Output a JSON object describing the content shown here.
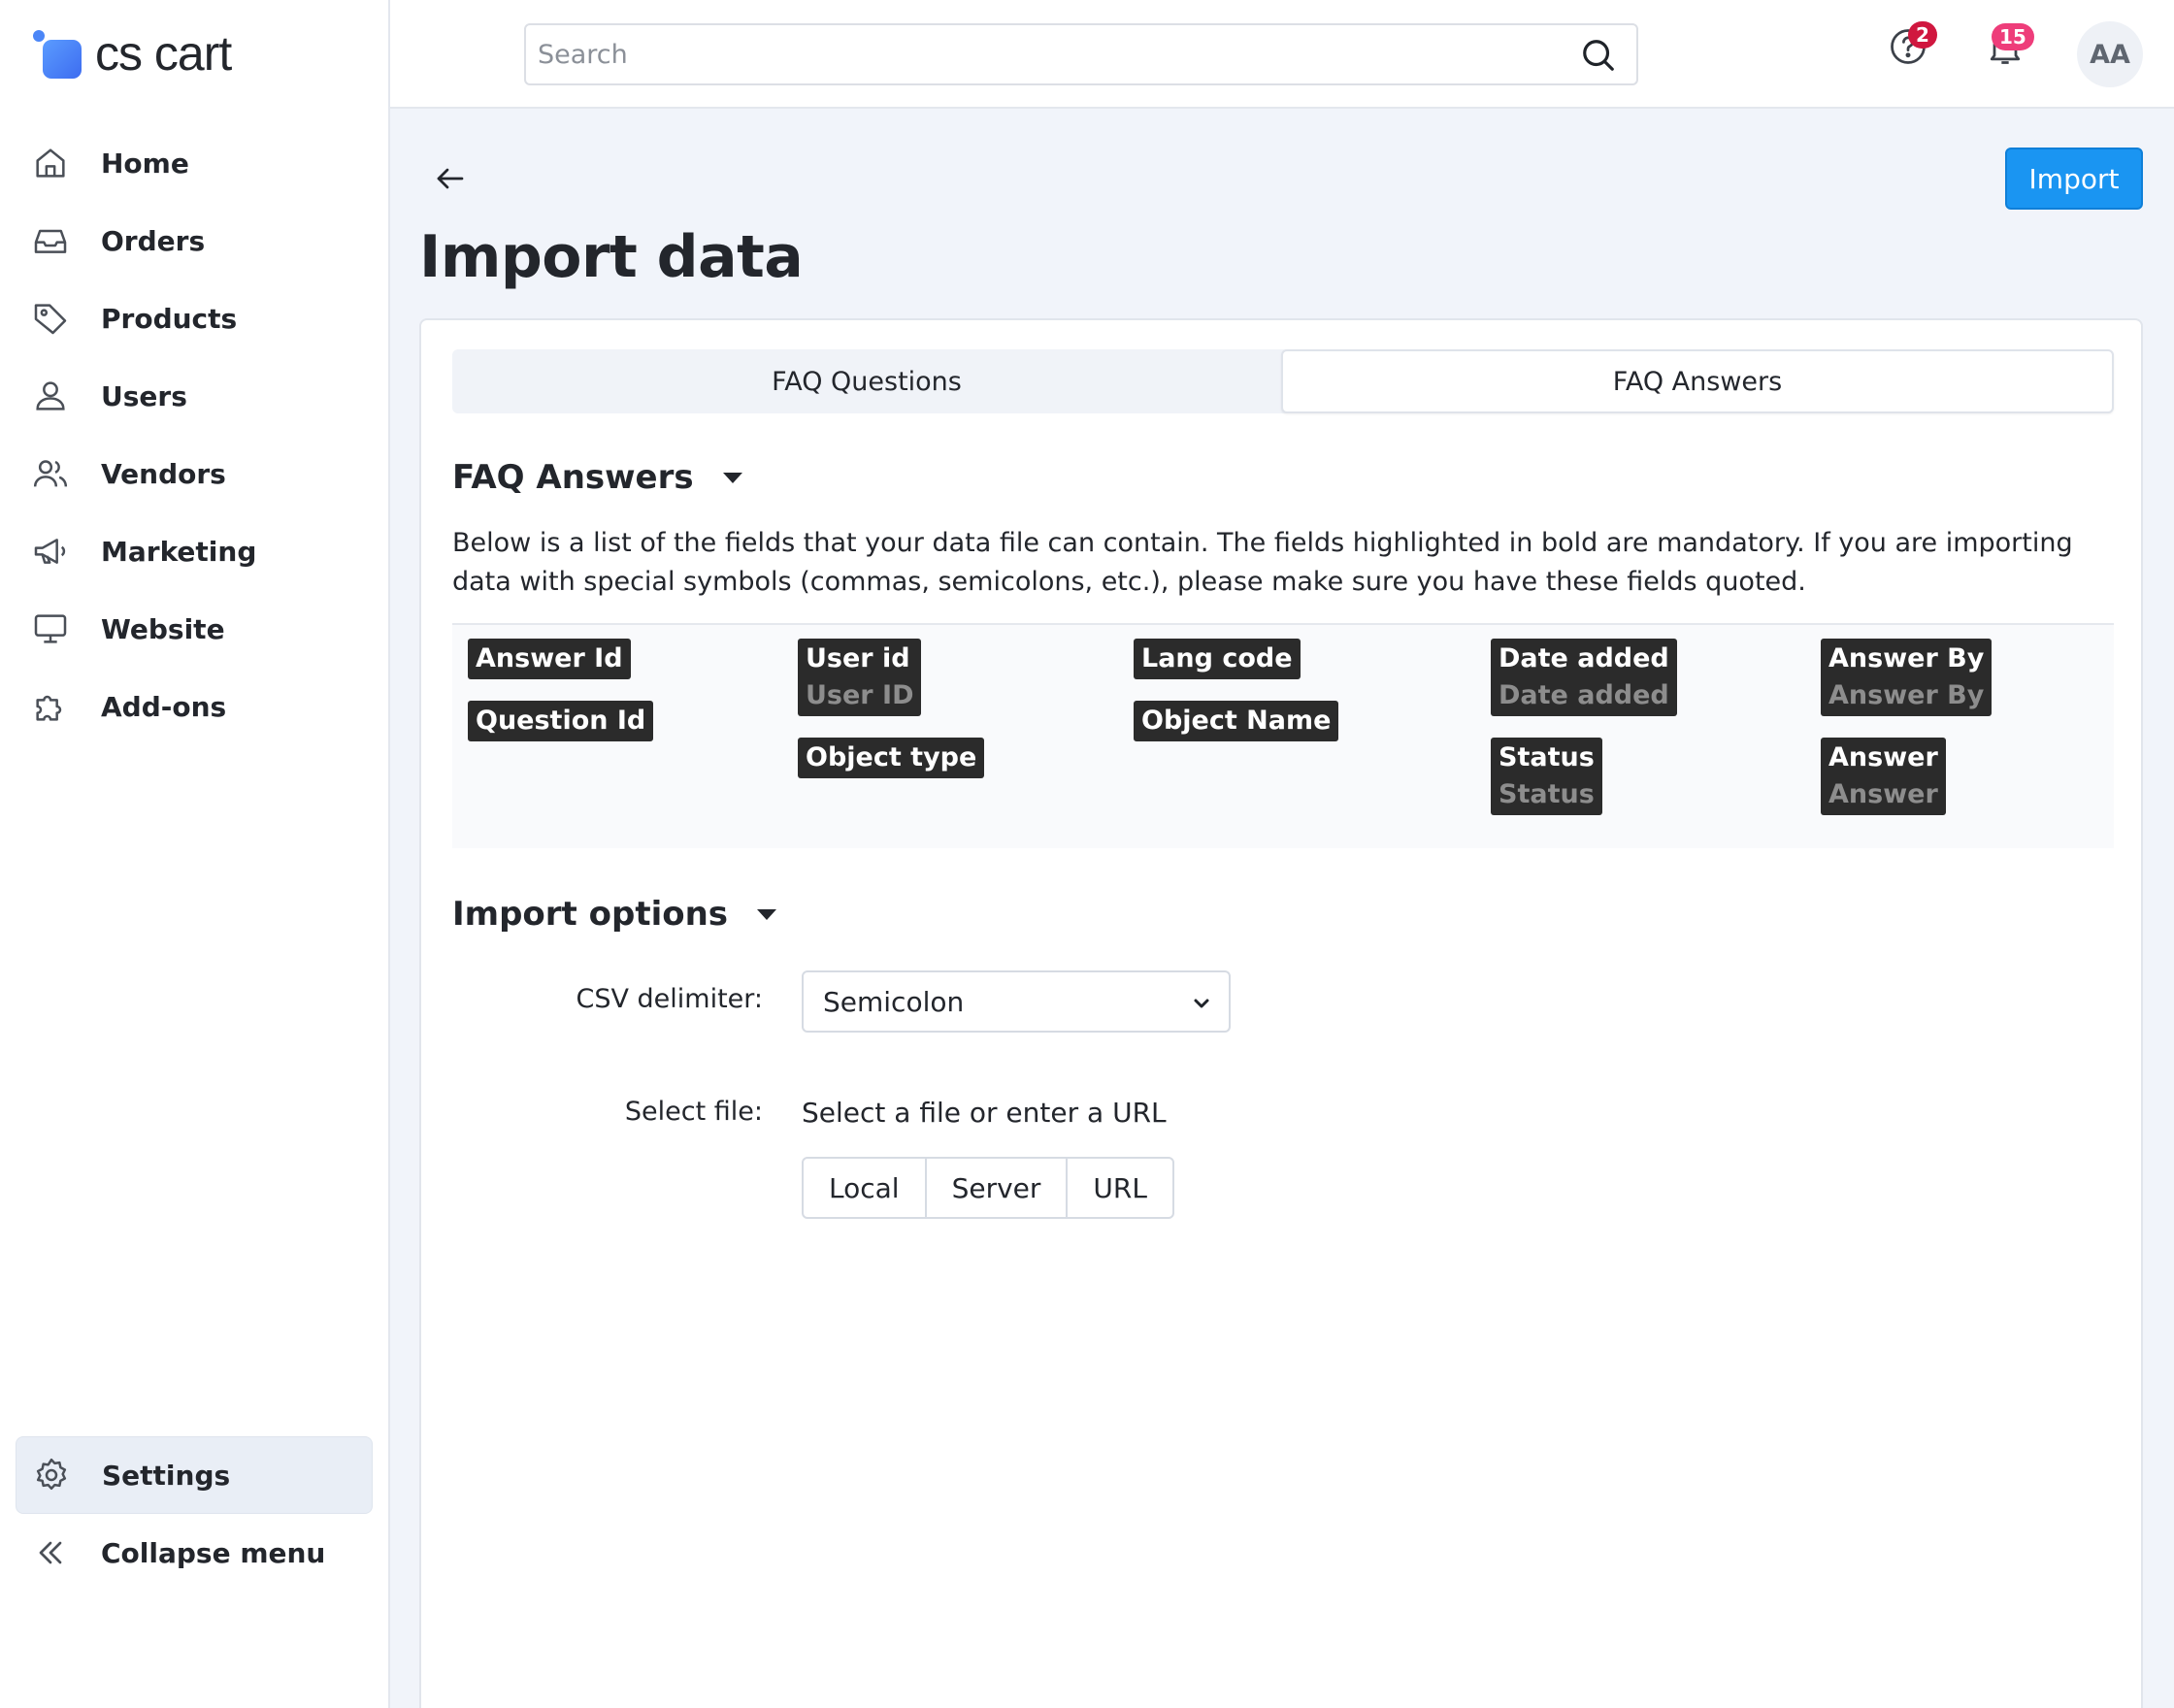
{
  "app": {
    "logo_text": "cs cart"
  },
  "sidebar": {
    "items": [
      {
        "label": "Home",
        "icon": "home-icon"
      },
      {
        "label": "Orders",
        "icon": "inbox-icon"
      },
      {
        "label": "Products",
        "icon": "tag-icon"
      },
      {
        "label": "Users",
        "icon": "user-icon"
      },
      {
        "label": "Vendors",
        "icon": "users-icon"
      },
      {
        "label": "Marketing",
        "icon": "megaphone-icon"
      },
      {
        "label": "Website",
        "icon": "monitor-icon"
      },
      {
        "label": "Add-ons",
        "icon": "puzzle-icon"
      }
    ],
    "settings_label": "Settings",
    "collapse_label": "Collapse menu"
  },
  "header": {
    "search_placeholder": "Search",
    "help_badge": "2",
    "notifications_badge": "15",
    "avatar_initials": "AA"
  },
  "page": {
    "title": "Import data",
    "import_button": "Import",
    "tabs": [
      {
        "label": "FAQ Questions",
        "active": false
      },
      {
        "label": "FAQ Answers",
        "active": true
      }
    ],
    "fields_section": {
      "title": "FAQ Answers",
      "description": "Below is a list of the fields that your data file can contain. The fields highlighted in bold are mandatory. If you are importing data with special symbols (commas, semicolons, etc.), please make sure you have these fields quoted.",
      "columns": [
        [
          {
            "name": "Answer Id"
          },
          {
            "name": "Question Id"
          }
        ],
        [
          {
            "name": "User id",
            "alias": "User ID"
          },
          {
            "name": "Object type"
          }
        ],
        [
          {
            "name": "Lang code"
          },
          {
            "name": "Object Name"
          }
        ],
        [
          {
            "name": "Date added",
            "alias": "Date added"
          },
          {
            "name": "Status",
            "alias": "Status"
          }
        ],
        [
          {
            "name": "Answer By",
            "alias": "Answer By"
          },
          {
            "name": "Answer",
            "alias": "Answer"
          }
        ]
      ]
    },
    "import_options": {
      "title": "Import options",
      "csv_delimiter_label": "CSV delimiter:",
      "csv_delimiter_value": "Semicolon",
      "select_file_label": "Select file:",
      "select_file_hint": "Select a file or enter a URL",
      "file_sources": [
        "Local",
        "Server",
        "URL"
      ]
    }
  },
  "colors": {
    "primary": "#1a95f2",
    "help_badge": "#d0173f",
    "notifications_badge": "#ee3d7a",
    "field_bg": "#2b2b2b"
  }
}
